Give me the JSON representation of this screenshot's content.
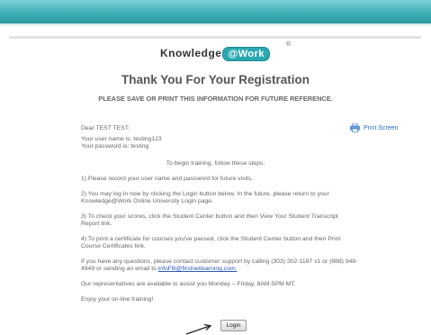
{
  "logo": {
    "left": "Knowledge",
    "at": "@Work",
    "registered": "®"
  },
  "title": "Thank You For Your Registration",
  "subtitle": "PLEASE SAVE OR PRINT THIS INFORMATION FOR FUTURE REFERENCE.",
  "greeting": "Dear TEST TEST:",
  "print_label": "Print Screen",
  "credentials": {
    "username_line": "Your user name is: testing123",
    "password_line": "Your password is: testing"
  },
  "steps_intro": "To begin training, follow these steps:",
  "steps": [
    "1) Please record your user name and password for future visits.",
    "2) You may log in now by clicking the Login button below. In the future, please return to your",
    "Knowledge@Work Online University Login page.",
    "3) To check your scores, click the Student Center button and then View Your Student Transcript",
    "Report link.",
    "4) To print a certificate for courses you've passed, click the Student Center button and then Print",
    "Course Certificates link."
  ],
  "support": {
    "line1": "If you have any questions, please contact customer support by calling (303) 302-1187 x1 or (888) 948-",
    "line2_prefix": "4949 or sending an email to ",
    "email": "infoFB@firstnetlearning.com."
  },
  "hours": "Our representatives are available to assist you Monday – Friday, 8AM-5PM MT.",
  "closing": "Enjoy your on-line training!",
  "login_label": "Login",
  "colors": {
    "header": "#2aa8b1",
    "link": "#2a58bf"
  }
}
